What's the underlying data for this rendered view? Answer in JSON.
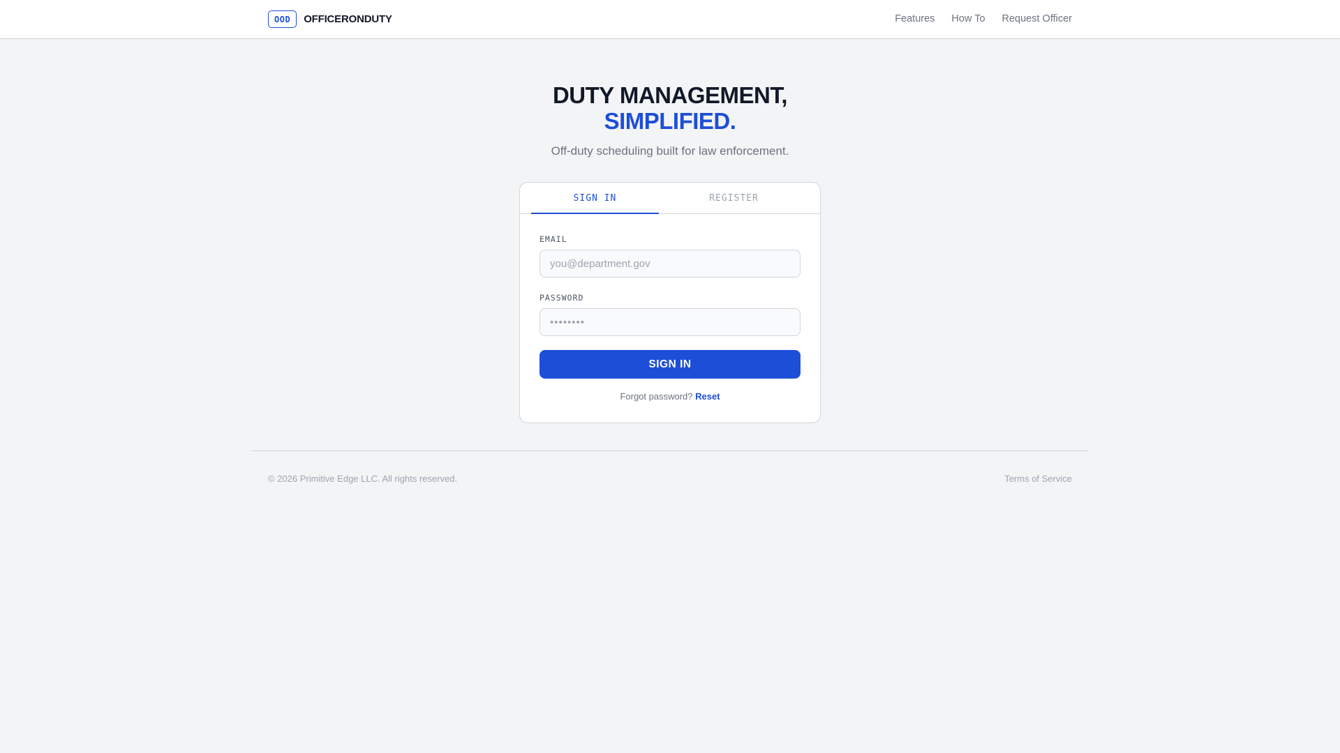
{
  "header": {
    "badge": "OOD",
    "brand": "OFFICERONDUTY",
    "nav": [
      {
        "label": "Features"
      },
      {
        "label": "How To"
      },
      {
        "label": "Request Officer"
      }
    ]
  },
  "hero": {
    "line1": "DUTY MANAGEMENT,",
    "line2": "SIMPLIFIED.",
    "subtitle": "Off-duty scheduling built for law enforcement."
  },
  "auth": {
    "tabs": [
      {
        "label": "SIGN IN",
        "active": true
      },
      {
        "label": "REGISTER",
        "active": false
      }
    ],
    "email": {
      "label": "EMAIL",
      "placeholder": "you@department.gov",
      "value": ""
    },
    "password": {
      "label": "PASSWORD",
      "placeholder": "••••••••",
      "value": ""
    },
    "submit_label": "SIGN IN",
    "forgot_text": "Forgot password?",
    "reset_label": "Reset"
  },
  "footer": {
    "copyright": "© 2026 Primitive Edge LLC. All rights reserved.",
    "terms": "Terms of Service"
  },
  "colors": {
    "accent": "#1d4ed8",
    "background": "#f3f4f6",
    "surface": "#ffffff",
    "muted_text": "#6b7280",
    "border": "#d1d5db"
  }
}
